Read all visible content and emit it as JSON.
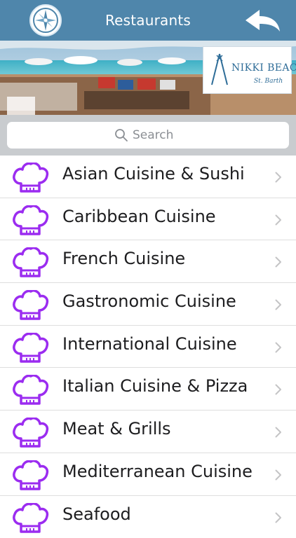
{
  "header": {
    "title": "Restaurants",
    "compass_icon": "compass-icon",
    "back_icon": "back-arrow-icon",
    "background_color": "#4f86ab"
  },
  "banner": {
    "logo": {
      "name": "NIKKI BEACH",
      "sub": "St. Barth"
    }
  },
  "search": {
    "placeholder": "Search",
    "icon": "search-icon"
  },
  "categories": {
    "icon": "chef-hat-icon",
    "icon_color": "#9b2cf0",
    "items": [
      {
        "label": "Asian Cuisine & Sushi"
      },
      {
        "label": "Caribbean Cuisine"
      },
      {
        "label": "French Cuisine"
      },
      {
        "label": "Gastronomic Cuisine"
      },
      {
        "label": "International Cuisine"
      },
      {
        "label": "Italian Cuisine & Pizza"
      },
      {
        "label": "Meat & Grills"
      },
      {
        "label": "Mediterranean Cuisine"
      },
      {
        "label": "Seafood"
      }
    ]
  }
}
